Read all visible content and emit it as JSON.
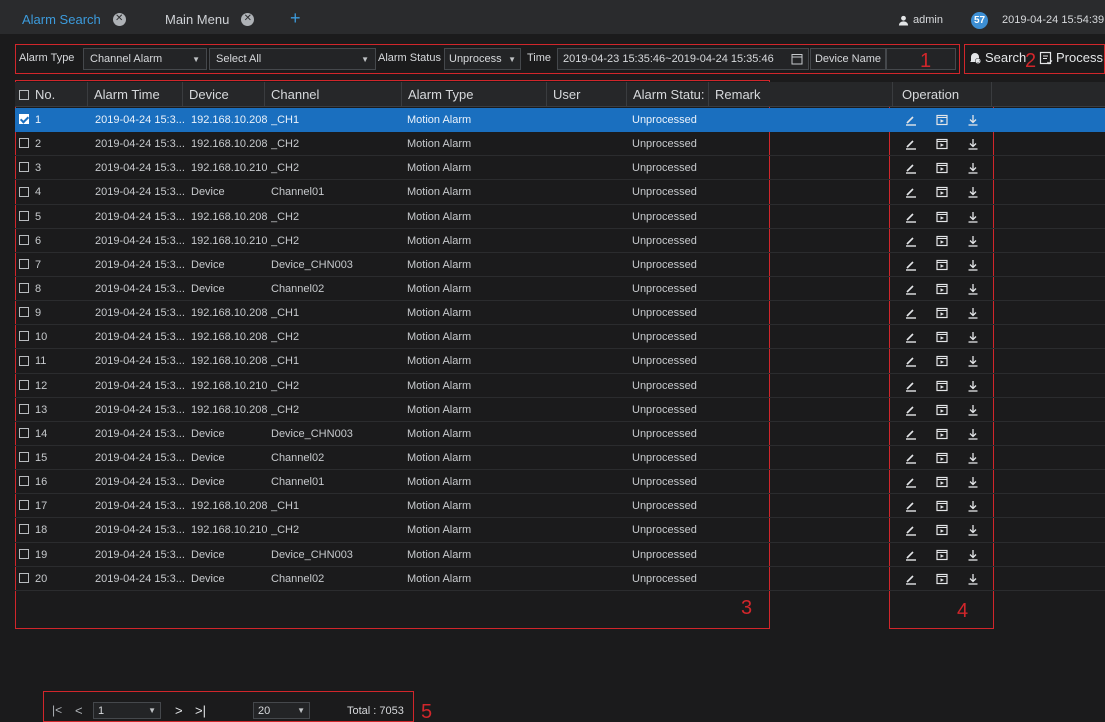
{
  "tabs": [
    {
      "label": "Alarm Search",
      "active": true
    },
    {
      "label": "Main Menu",
      "active": false
    }
  ],
  "topbar": {
    "user": "admin",
    "notification_count": "57",
    "datetime": "2019-04-24 15:54:39"
  },
  "filters": {
    "alarm_type_label": "Alarm Type",
    "alarm_type_value": "Channel Alarm",
    "channel_value": "Select All",
    "alarm_status_label": "Alarm Status",
    "alarm_status_value": "Unprocess",
    "time_label": "Time",
    "time_value": "2019-04-23 15:35:46~2019-04-24 15:35:46",
    "device_name_label": "Device Name",
    "device_name_value": "",
    "search_label": "Search",
    "process_label": "Process"
  },
  "callouts": [
    "1",
    "2",
    "3",
    "4",
    "5"
  ],
  "table": {
    "columns": [
      "No.",
      "Alarm Time",
      "Device",
      "Channel",
      "Alarm Type",
      "User",
      "Alarm Statu:",
      "Remark",
      "Operation"
    ],
    "rows": [
      {
        "no": "1",
        "time": "2019-04-24 15:3...",
        "device": "192.168.10.208",
        "channel": "_CH1",
        "type": "Motion Alarm",
        "user": "",
        "status": "Unprocessed",
        "remark": "",
        "checked": true
      },
      {
        "no": "2",
        "time": "2019-04-24 15:3...",
        "device": "192.168.10.208",
        "channel": "_CH2",
        "type": "Motion Alarm",
        "user": "",
        "status": "Unprocessed",
        "remark": "",
        "checked": false
      },
      {
        "no": "3",
        "time": "2019-04-24 15:3...",
        "device": "192.168.10.210",
        "channel": "_CH2",
        "type": "Motion Alarm",
        "user": "",
        "status": "Unprocessed",
        "remark": "",
        "checked": false
      },
      {
        "no": "4",
        "time": "2019-04-24 15:3...",
        "device": "Device",
        "channel": "Channel01",
        "type": "Motion Alarm",
        "user": "",
        "status": "Unprocessed",
        "remark": "",
        "checked": false
      },
      {
        "no": "5",
        "time": "2019-04-24 15:3...",
        "device": "192.168.10.208",
        "channel": "_CH2",
        "type": "Motion Alarm",
        "user": "",
        "status": "Unprocessed",
        "remark": "",
        "checked": false
      },
      {
        "no": "6",
        "time": "2019-04-24 15:3...",
        "device": "192.168.10.210",
        "channel": "_CH2",
        "type": "Motion Alarm",
        "user": "",
        "status": "Unprocessed",
        "remark": "",
        "checked": false
      },
      {
        "no": "7",
        "time": "2019-04-24 15:3...",
        "device": "Device",
        "channel": "Device_CHN003",
        "type": "Motion Alarm",
        "user": "",
        "status": "Unprocessed",
        "remark": "",
        "checked": false
      },
      {
        "no": "8",
        "time": "2019-04-24 15:3...",
        "device": "Device",
        "channel": "Channel02",
        "type": "Motion Alarm",
        "user": "",
        "status": "Unprocessed",
        "remark": "",
        "checked": false
      },
      {
        "no": "9",
        "time": "2019-04-24 15:3...",
        "device": "192.168.10.208",
        "channel": "_CH1",
        "type": "Motion Alarm",
        "user": "",
        "status": "Unprocessed",
        "remark": "",
        "checked": false
      },
      {
        "no": "10",
        "time": "2019-04-24 15:3...",
        "device": "192.168.10.208",
        "channel": "_CH2",
        "type": "Motion Alarm",
        "user": "",
        "status": "Unprocessed",
        "remark": "",
        "checked": false
      },
      {
        "no": "11",
        "time": "2019-04-24 15:3...",
        "device": "192.168.10.208",
        "channel": "_CH1",
        "type": "Motion Alarm",
        "user": "",
        "status": "Unprocessed",
        "remark": "",
        "checked": false
      },
      {
        "no": "12",
        "time": "2019-04-24 15:3...",
        "device": "192.168.10.210",
        "channel": "_CH2",
        "type": "Motion Alarm",
        "user": "",
        "status": "Unprocessed",
        "remark": "",
        "checked": false
      },
      {
        "no": "13",
        "time": "2019-04-24 15:3...",
        "device": "192.168.10.208",
        "channel": "_CH2",
        "type": "Motion Alarm",
        "user": "",
        "status": "Unprocessed",
        "remark": "",
        "checked": false
      },
      {
        "no": "14",
        "time": "2019-04-24 15:3...",
        "device": "Device",
        "channel": "Device_CHN003",
        "type": "Motion Alarm",
        "user": "",
        "status": "Unprocessed",
        "remark": "",
        "checked": false
      },
      {
        "no": "15",
        "time": "2019-04-24 15:3...",
        "device": "Device",
        "channel": "Channel02",
        "type": "Motion Alarm",
        "user": "",
        "status": "Unprocessed",
        "remark": "",
        "checked": false
      },
      {
        "no": "16",
        "time": "2019-04-24 15:3...",
        "device": "Device",
        "channel": "Channel01",
        "type": "Motion Alarm",
        "user": "",
        "status": "Unprocessed",
        "remark": "",
        "checked": false
      },
      {
        "no": "17",
        "time": "2019-04-24 15:3...",
        "device": "192.168.10.208",
        "channel": "_CH1",
        "type": "Motion Alarm",
        "user": "",
        "status": "Unprocessed",
        "remark": "",
        "checked": false
      },
      {
        "no": "18",
        "time": "2019-04-24 15:3...",
        "device": "192.168.10.210",
        "channel": "_CH2",
        "type": "Motion Alarm",
        "user": "",
        "status": "Unprocessed",
        "remark": "",
        "checked": false
      },
      {
        "no": "19",
        "time": "2019-04-24 15:3...",
        "device": "Device",
        "channel": "Device_CHN003",
        "type": "Motion Alarm",
        "user": "",
        "status": "Unprocessed",
        "remark": "",
        "checked": false
      },
      {
        "no": "20",
        "time": "2019-04-24 15:3...",
        "device": "Device",
        "channel": "Channel02",
        "type": "Motion Alarm",
        "user": "",
        "status": "Unprocessed",
        "remark": "",
        "checked": false
      }
    ],
    "operation_icons": [
      "edit-icon",
      "playback-icon",
      "download-icon"
    ]
  },
  "pagination": {
    "page": "1",
    "page_size": "20",
    "total": "Total : 7053"
  },
  "colors": {
    "accent": "#3c9bdc",
    "selected_row": "#1a6fbf",
    "callout_red": "#d1262b",
    "background": "#1b1b1c"
  }
}
